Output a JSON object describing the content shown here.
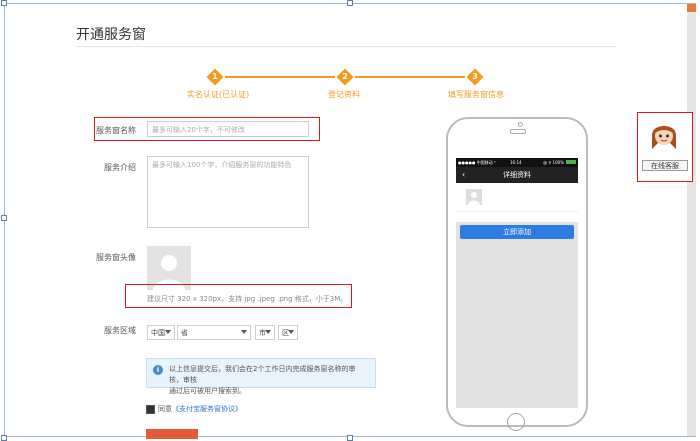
{
  "page": {
    "title": "开通服务窗"
  },
  "steps": [
    {
      "num": "1",
      "label": "实名认证(已认证)"
    },
    {
      "num": "2",
      "label": "登记资料"
    },
    {
      "num": "3",
      "label": "填写服务窗信息"
    }
  ],
  "form": {
    "name_label": "服务窗名称",
    "name_placeholder": "最多可输入20个字，不可修改",
    "intro_label": "服务介绍",
    "intro_placeholder": "最多可输入100个字，介绍服务窗的功能特色",
    "avatar_label": "服务窗头像",
    "avatar_hint": "建议尺寸 320 x 320px，支持.jpg .jpeg .png 格式，小于3M。",
    "region_label": "服务区域",
    "country": "中国",
    "province": "省",
    "city": "市",
    "district": "区",
    "info_line1": "以上信息提交后，我们会在2个工作日内完成服务窗名称的审核，审核",
    "info_line2": "通过后可被用户搜索到。",
    "agree_text": "同意",
    "agree_link": "《支付宝服务窗协议》"
  },
  "phone_preview": {
    "status_left": "●●●●● 中国移动 ᴱ",
    "status_time": "16:14",
    "status_right": "@ ⚲ 100%",
    "nav_title": "详细资料",
    "add_button": "立即添加"
  },
  "customer_service": {
    "label": "在线客服"
  },
  "colors": {
    "accent": "#f29b1f",
    "highlight": "#d61b1b",
    "primary": "#2d7de0"
  }
}
